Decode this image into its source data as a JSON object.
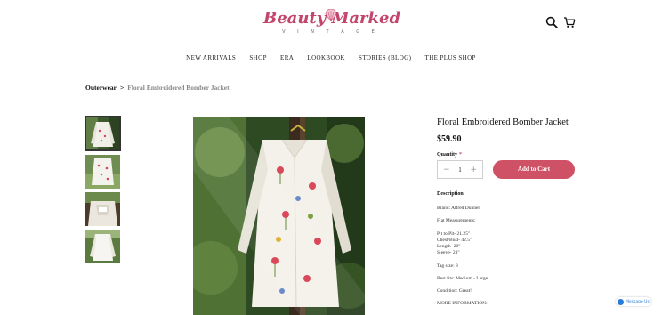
{
  "brand": {
    "name": "Beauty Marked",
    "tagline": "V I N T A G E"
  },
  "nav": {
    "items": [
      "NEW ARRIVALS",
      "SHOP",
      "ERA",
      "LOOKBOOK",
      "STORIES (BLOG)",
      "THE PLUS SHOP"
    ]
  },
  "breadcrumb": {
    "root": "Outerwear",
    "separator": ">",
    "current": "Floral Embroidered Bomber Jacket"
  },
  "product": {
    "title": "Floral Embroidered Bomber Jacket",
    "price": "$59.90",
    "quantity_label": "Quantity",
    "required_mark": "*",
    "quantity_value": "1",
    "minus": "−",
    "plus": "+",
    "add_to_cart": "Add to Cart",
    "description_title": "Description",
    "description": [
      "Brand: Alfred Dunner",
      "Flat Measurements:",
      "Pit to Pit- 21.25\"",
      "Chest/Bust- 42.5\"",
      "Length- 20\"",
      "Sleeve- 23\"",
      "Tag size: 8",
      "Best fits: Medium - Large",
      "Condition: Great!",
      "MORE INFORMATION:"
    ]
  },
  "thumbnails": {
    "count": 4,
    "active_index": 0
  },
  "icons": {
    "search": "search-icon",
    "cart": "cart-icon",
    "messenger": "messenger-icon"
  },
  "colors": {
    "accent": "#cf5166",
    "brand": "#c2456c"
  },
  "chat": {
    "label": "Message Us"
  }
}
